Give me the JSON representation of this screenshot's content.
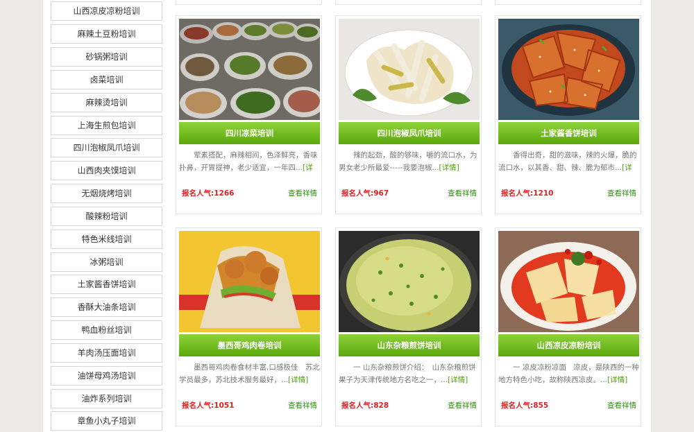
{
  "sidebar": {
    "items": [
      {
        "label": "山西凉皮凉粉培训"
      },
      {
        "label": "麻辣土豆粉培训"
      },
      {
        "label": "砂锅粥培训"
      },
      {
        "label": "卤菜培训"
      },
      {
        "label": "麻辣烫培训"
      },
      {
        "label": "上海生煎包培训"
      },
      {
        "label": "四川泡椒凤爪培训"
      },
      {
        "label": "山西肉夹馍培训"
      },
      {
        "label": "无烟烧烤培训"
      },
      {
        "label": "酸辣粉培训"
      },
      {
        "label": "特色米线培训"
      },
      {
        "label": "冰粥培训"
      },
      {
        "label": "土家酱香饼培训"
      },
      {
        "label": "香酥大油条培训"
      },
      {
        "label": "鸭血粉丝培训"
      },
      {
        "label": "羊肉汤压面培训"
      },
      {
        "label": "油饼母鸡汤培训"
      },
      {
        "label": "油炸系列培训"
      },
      {
        "label": "章鱼小丸子培训"
      }
    ]
  },
  "common": {
    "popularity_label": "报名人气:",
    "detail_label": "查看祥情",
    "more_label": "[详情]"
  },
  "cards": [
    {
      "title": "四川凉菜培训",
      "desc": "荤素搭配，麻辣相间，色泽鲜亮，香味扑鼻，开胃提神，老少适宜，一年四...",
      "popularity": "1266"
    },
    {
      "title": "四川泡椒凤爪培训",
      "desc": "辣的起劲，酸的够味，嚼的流口水，为男女老少所最爱-----我要泡椒...",
      "popularity": "967"
    },
    {
      "title": "土家酱香饼培训",
      "desc": "香得出奇，甜的滋味，辣的火爆，脆的流口水，以其香、甜、辣、脆为郁市...",
      "popularity": "1210"
    },
    {
      "title": "墨西哥鸡肉卷培训",
      "desc": "墨西哥鸡肉卷食材丰富,口感极佳　苏北学员最多，苏北技术服务最好，...",
      "popularity": "1051"
    },
    {
      "title": "山东杂粮煎饼培训",
      "desc": "一 山东杂粮煎饼介绍：　山东杂粮煎饼果子为天津传统地方名吃之一，...",
      "popularity": "828"
    },
    {
      "title": "山西凉皮凉粉培训",
      "desc": "一 凉皮凉粉凉面　凉皮，是陕西的一种地方特色小吃，故称陕西凉皮。...",
      "popularity": "855"
    }
  ]
}
